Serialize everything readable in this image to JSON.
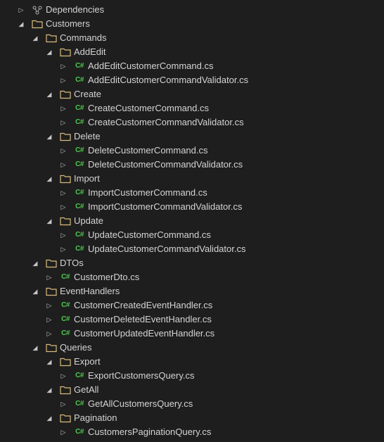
{
  "icons": {
    "dep": "dep",
    "folder": "folder",
    "cs": "cs"
  },
  "arrows": {
    "collapsed": "▷",
    "expanded": "◢"
  },
  "tree": [
    {
      "depth": 0,
      "expand": "collapsed",
      "icon": "dep",
      "label": "Dependencies"
    },
    {
      "depth": 0,
      "expand": "expanded",
      "icon": "folder",
      "label": "Customers"
    },
    {
      "depth": 1,
      "expand": "expanded",
      "icon": "folder",
      "label": "Commands"
    },
    {
      "depth": 2,
      "expand": "expanded",
      "icon": "folder",
      "label": "AddEdit"
    },
    {
      "depth": 3,
      "expand": "collapsed",
      "icon": "cs",
      "label": "AddEditCustomerCommand.cs"
    },
    {
      "depth": 3,
      "expand": "collapsed",
      "icon": "cs",
      "label": "AddEditCustomerCommandValidator.cs"
    },
    {
      "depth": 2,
      "expand": "expanded",
      "icon": "folder",
      "label": "Create"
    },
    {
      "depth": 3,
      "expand": "collapsed",
      "icon": "cs",
      "label": "CreateCustomerCommand.cs"
    },
    {
      "depth": 3,
      "expand": "collapsed",
      "icon": "cs",
      "label": "CreateCustomerCommandValidator.cs"
    },
    {
      "depth": 2,
      "expand": "expanded",
      "icon": "folder",
      "label": "Delete"
    },
    {
      "depth": 3,
      "expand": "collapsed",
      "icon": "cs",
      "label": "DeleteCustomerCommand.cs"
    },
    {
      "depth": 3,
      "expand": "collapsed",
      "icon": "cs",
      "label": "DeleteCustomerCommandValidator.cs"
    },
    {
      "depth": 2,
      "expand": "expanded",
      "icon": "folder",
      "label": "Import"
    },
    {
      "depth": 3,
      "expand": "collapsed",
      "icon": "cs",
      "label": "ImportCustomerCommand.cs"
    },
    {
      "depth": 3,
      "expand": "collapsed",
      "icon": "cs",
      "label": "ImportCustomerCommandValidator.cs"
    },
    {
      "depth": 2,
      "expand": "expanded",
      "icon": "folder",
      "label": "Update"
    },
    {
      "depth": 3,
      "expand": "collapsed",
      "icon": "cs",
      "label": "UpdateCustomerCommand.cs"
    },
    {
      "depth": 3,
      "expand": "collapsed",
      "icon": "cs",
      "label": "UpdateCustomerCommandValidator.cs"
    },
    {
      "depth": 1,
      "expand": "expanded",
      "icon": "folder",
      "label": "DTOs"
    },
    {
      "depth": 2,
      "expand": "collapsed",
      "icon": "cs",
      "label": "CustomerDto.cs"
    },
    {
      "depth": 1,
      "expand": "expanded",
      "icon": "folder",
      "label": "EventHandlers"
    },
    {
      "depth": 2,
      "expand": "collapsed",
      "icon": "cs",
      "label": "CustomerCreatedEventHandler.cs"
    },
    {
      "depth": 2,
      "expand": "collapsed",
      "icon": "cs",
      "label": "CustomerDeletedEventHandler.cs"
    },
    {
      "depth": 2,
      "expand": "collapsed",
      "icon": "cs",
      "label": "CustomerUpdatedEventHandler.cs"
    },
    {
      "depth": 1,
      "expand": "expanded",
      "icon": "folder",
      "label": "Queries"
    },
    {
      "depth": 2,
      "expand": "expanded",
      "icon": "folder",
      "label": "Export"
    },
    {
      "depth": 3,
      "expand": "collapsed",
      "icon": "cs",
      "label": "ExportCustomersQuery.cs"
    },
    {
      "depth": 2,
      "expand": "expanded",
      "icon": "folder",
      "label": "GetAll"
    },
    {
      "depth": 3,
      "expand": "collapsed",
      "icon": "cs",
      "label": "GetAllCustomersQuery.cs"
    },
    {
      "depth": 2,
      "expand": "expanded",
      "icon": "folder",
      "label": "Pagination"
    },
    {
      "depth": 3,
      "expand": "collapsed",
      "icon": "cs",
      "label": "CustomersPaginationQuery.cs"
    }
  ]
}
